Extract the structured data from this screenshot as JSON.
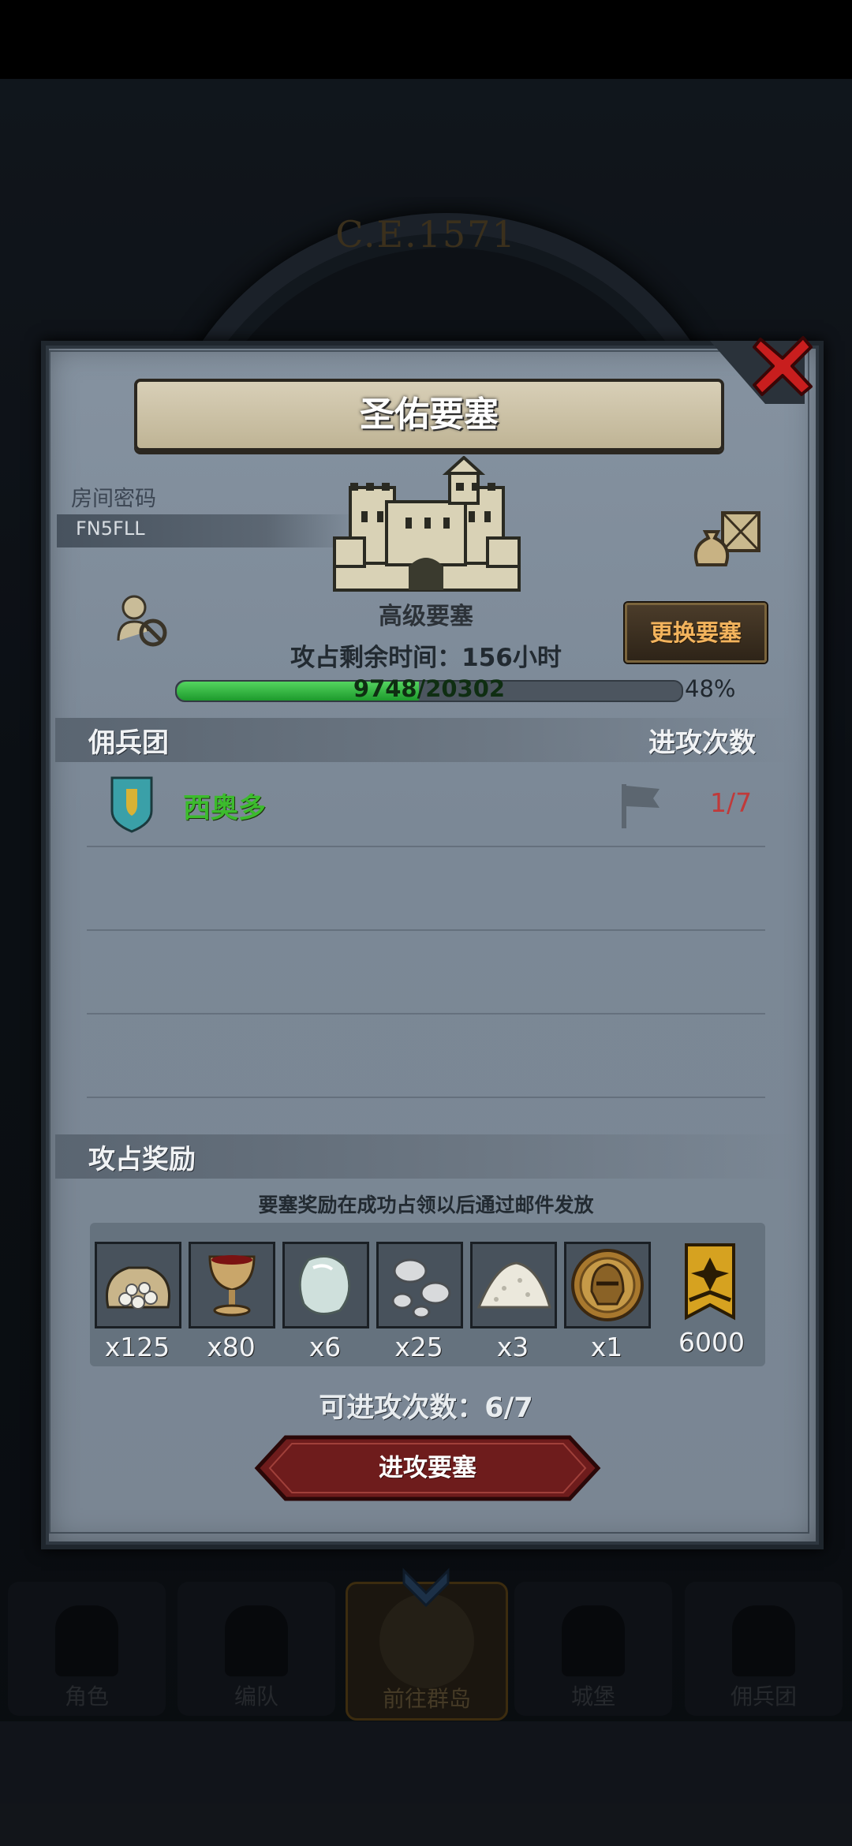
{
  "background": {
    "era_text": "C.E.1571",
    "nav": [
      {
        "label": "角色",
        "icon": "character-icon"
      },
      {
        "label": "编队",
        "icon": "formation-icon"
      },
      {
        "label": "前往群岛",
        "icon": "islands-icon",
        "active": true
      },
      {
        "label": "城堡",
        "icon": "castle-icon"
      },
      {
        "label": "佣兵团",
        "icon": "mercenary-icon"
      }
    ]
  },
  "dialog": {
    "title": "圣佑要塞",
    "room_label": "房间密码",
    "room_code": "FN5FLL",
    "fortress_level": "高级要塞",
    "change_button": "更换要塞",
    "time_left": "攻占剩余时间：156小时",
    "progress": {
      "text": "9748/20302",
      "current": 9748,
      "max": 20302,
      "percent_text": "48%"
    },
    "mercenary_header": "佣兵团",
    "attack_count_header": "进攻次数",
    "mercenaries": [
      {
        "name": "西奥多",
        "attacks": "1/7",
        "shield_color": "#3aa0a8"
      }
    ],
    "rewards_header": "攻占奖励",
    "rewards_note": "要塞奖励在成功占领以后通过邮件发放",
    "rewards": [
      {
        "icon": "stone-sack-icon",
        "qty": "x125"
      },
      {
        "icon": "goblet-icon",
        "qty": "x80"
      },
      {
        "icon": "gem-icon",
        "qty": "x6"
      },
      {
        "icon": "silver-coins-icon",
        "qty": "x25"
      },
      {
        "icon": "salt-pile-icon",
        "qty": "x3"
      },
      {
        "icon": "knight-helmet-icon",
        "qty": "x1"
      },
      {
        "icon": "banner-icon",
        "qty": "6000"
      }
    ],
    "attempts_left": "可进攻次数：6/7",
    "attack_button": "进攻要塞"
  },
  "colors": {
    "panel": "#808d9b",
    "progress_green": "#2fb040",
    "accent_orange": "#f2b35d",
    "button_red": "#6e1c1c"
  }
}
